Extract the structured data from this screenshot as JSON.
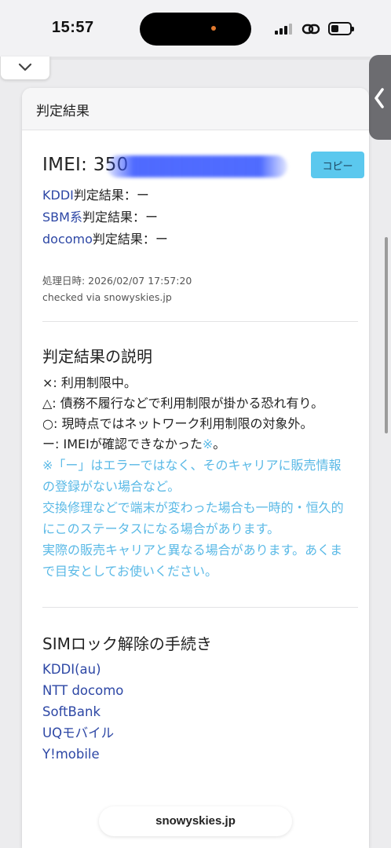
{
  "status_bar": {
    "time": "15:57"
  },
  "card": {
    "header": "判定結果",
    "imei_label": "IMEI: 350",
    "copy_button": "コピー",
    "results": [
      {
        "carrier": "KDDI",
        "label": "判定結果：ー"
      },
      {
        "carrier": "SBM系",
        "label": "判定結果：ー"
      },
      {
        "carrier": "docomo",
        "label": "判定結果：ー"
      }
    ],
    "processed_at": "処理日時: 2026/02/07 17:57:20",
    "checked_via": "checked via snowyskies.jp"
  },
  "explanation": {
    "title": "判定結果の説明",
    "lines": [
      "×: 利用制限中。",
      "△: 債務不履行などで利用制限が掛かる恐れ有り。",
      "○: 現時点ではネットワーク利用制限の対象外。"
    ],
    "line_dash": "ー: IMEIが確認できなかった",
    "line_dash_mark": "※",
    "line_dash_end": "。",
    "notes": [
      "※「ー」はエラーではなく、そのキャリアに販売情報の登録がない場合など。",
      "交換修理などで端末が変わった場合も一時的・恒久的にこのステータスになる場合があります。",
      "実際の販売キャリアと異なる場合があります。あくまで目安としてお使いください。"
    ]
  },
  "sim_unlock": {
    "title": "SIMロック解除の手続き",
    "links": [
      "KDDI(au)",
      "NTT docomo",
      "SoftBank",
      "UQモバイル",
      "Y!mobile"
    ]
  },
  "url_bar": {
    "domain": "snowyskies.jp"
  }
}
